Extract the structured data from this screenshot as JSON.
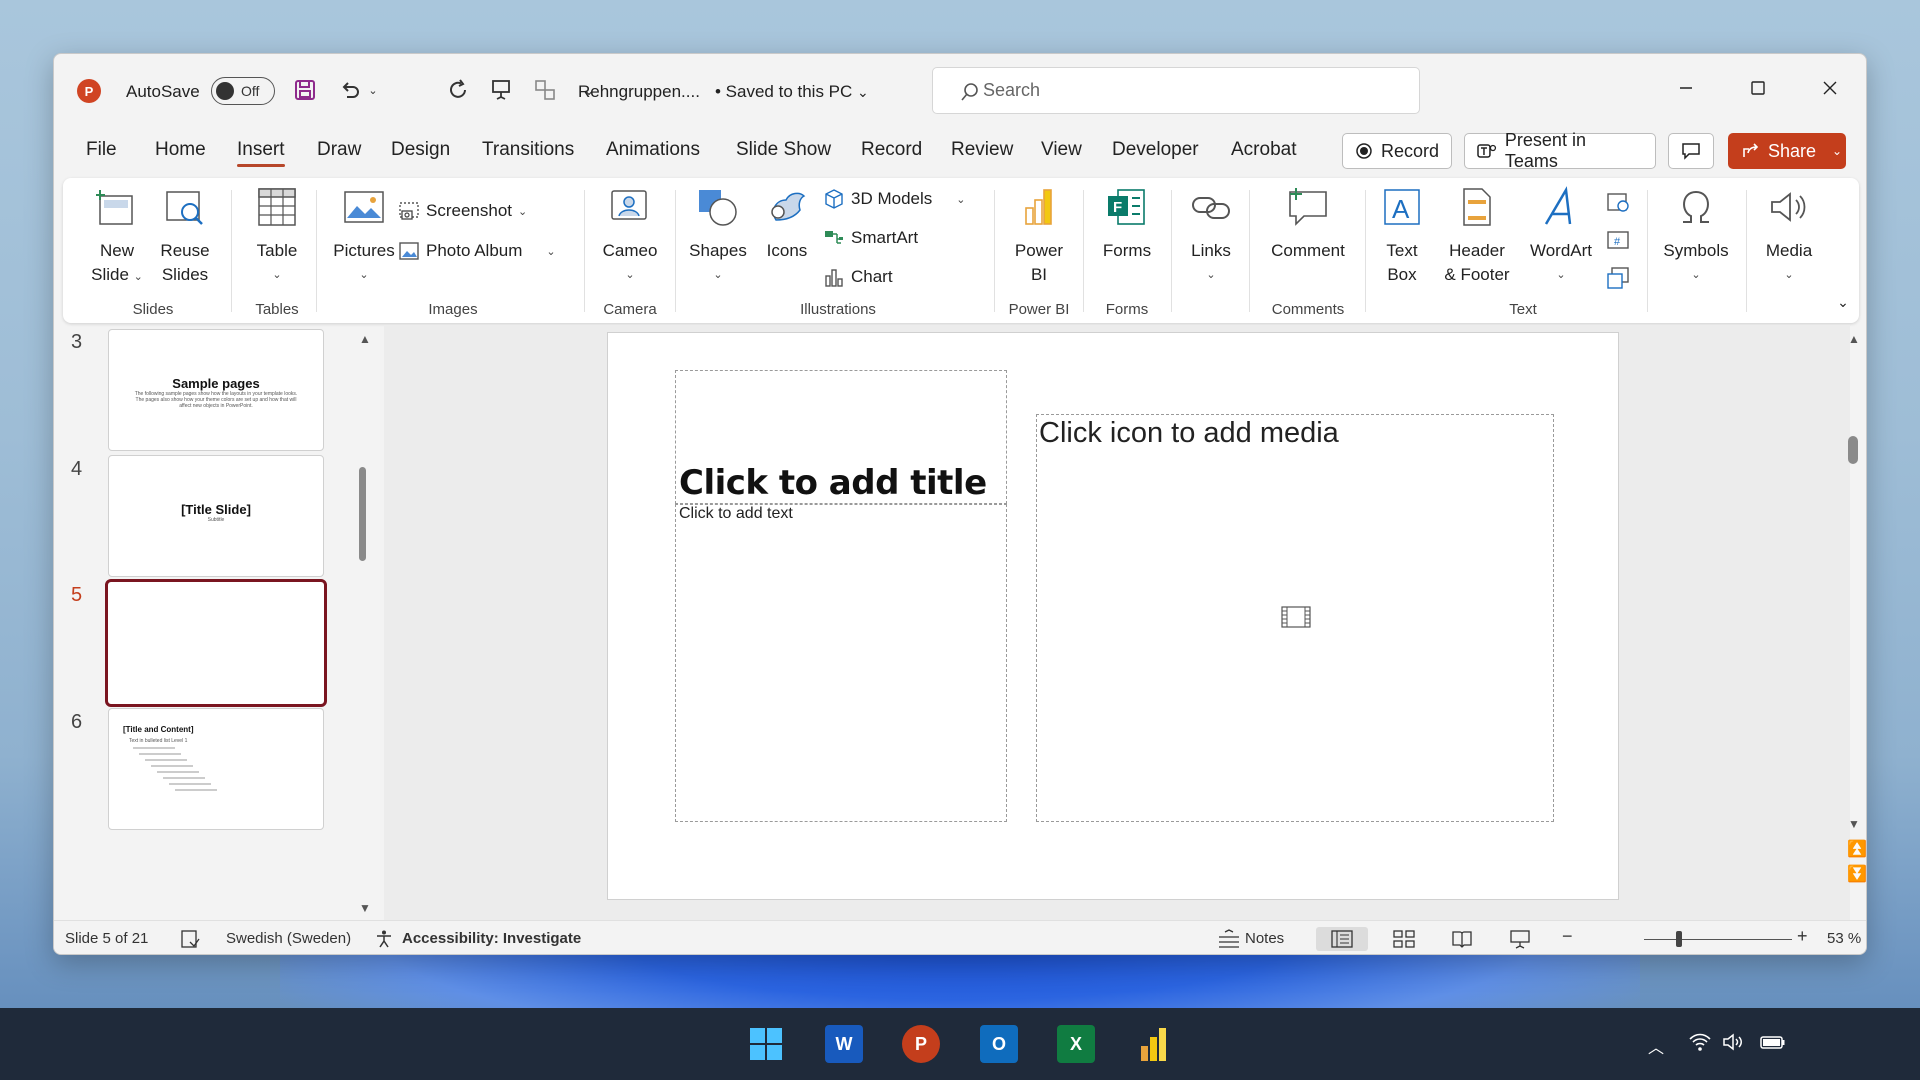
{
  "titlebar": {
    "autosave_label": "AutoSave",
    "autosave_state": "Off",
    "doc_name": "Rehngruppen....",
    "save_status": "• Saved to this PC",
    "search_placeholder": "Search"
  },
  "tabs": [
    "File",
    "Home",
    "Insert",
    "Draw",
    "Design",
    "Transitions",
    "Animations",
    "Slide Show",
    "Record",
    "Review",
    "View",
    "Developer",
    "Acrobat"
  ],
  "active_tab": "Insert",
  "header_buttons": {
    "record": "Record",
    "present_in_teams": "Present in Teams",
    "share": "Share"
  },
  "ribbon": {
    "slides": {
      "new_slide_1": "New",
      "new_slide_2": "Slide",
      "reuse_1": "Reuse",
      "reuse_2": "Slides",
      "label": "Slides"
    },
    "tables": {
      "table": "Table",
      "label": "Tables"
    },
    "images": {
      "pictures": "Pictures",
      "screenshot": "Screenshot",
      "photo_album": "Photo Album",
      "label": "Images"
    },
    "camera": {
      "cameo": "Cameo",
      "label": "Camera"
    },
    "illustrations": {
      "shapes": "Shapes",
      "icons": "Icons",
      "models_3d": "3D Models",
      "smartart": "SmartArt",
      "chart": "Chart",
      "label": "Illustrations"
    },
    "powerbi": {
      "line1": "Power",
      "line2": "BI",
      "label": "Power BI"
    },
    "forms": {
      "forms": "Forms",
      "label": "Forms"
    },
    "links": {
      "links": "Links"
    },
    "comments": {
      "comment": "Comment",
      "label": "Comments"
    },
    "text": {
      "textbox_1": "Text",
      "textbox_2": "Box",
      "header_1": "Header",
      "header_2": "& Footer",
      "wordart": "WordArt",
      "label": "Text"
    },
    "symbols": {
      "symbols": "Symbols"
    },
    "media": {
      "media": "Media"
    }
  },
  "thumbnails": [
    {
      "num": "3",
      "title": "Sample pages",
      "sub": "The following sample pages show how the layouts in your template looks. The pages also show how your theme colors are set up and how that will affect new objects in PowerPoint."
    },
    {
      "num": "4",
      "title": "[Title Slide]",
      "sub": "Subtitle"
    },
    {
      "num": "5",
      "title": "",
      "sub": ""
    },
    {
      "num": "6",
      "title": "[Title and Content]",
      "sub": "Text in bulleted list Level 1"
    }
  ],
  "slide": {
    "title_placeholder": "Click to add title",
    "text_placeholder": "Click to add text",
    "media_placeholder": "Click icon to add media"
  },
  "statusbar": {
    "slide_info": "Slide 5 of 21",
    "language": "Swedish (Sweden)",
    "accessibility": "Accessibility: Investigate",
    "notes": "Notes",
    "zoom": "53 %"
  },
  "colors": {
    "accent": "#b7472a",
    "share": "#c43e1c",
    "active_thumb_border": "#7a1520"
  }
}
